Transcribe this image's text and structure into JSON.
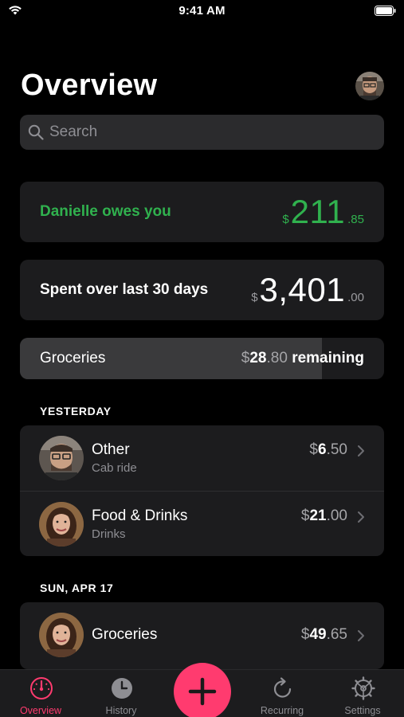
{
  "status_bar": {
    "time": "9:41 AM"
  },
  "header": {
    "title": "Overview"
  },
  "search": {
    "placeholder": "Search"
  },
  "owes_card": {
    "label": "Danielle owes you",
    "currency": "$",
    "whole": "211",
    "cents": ".85"
  },
  "spent_card": {
    "label": "Spent over last 30 days",
    "currency": "$",
    "whole": "3,401",
    "cents": ".00"
  },
  "budget": {
    "label": "Groceries",
    "amount_currency": "$",
    "amount_whole": "28",
    "amount_cents": ".80",
    "suffix": " remaining",
    "fill_fraction": 0.83
  },
  "sections": [
    {
      "header": "YESTERDAY",
      "items": [
        {
          "title": "Other",
          "subtitle": "Cab ride",
          "currency": "$",
          "whole": "6",
          "cents": ".50",
          "avatar": "man-avatar"
        },
        {
          "title": "Food & Drinks",
          "subtitle": "Drinks",
          "currency": "$",
          "whole": "21",
          "cents": ".00",
          "avatar": "woman-avatar"
        }
      ]
    },
    {
      "header": "SUN, APR 17",
      "items": [
        {
          "title": "Groceries",
          "currency": "$",
          "whole": "49",
          "cents": ".65",
          "avatar": "woman-avatar"
        }
      ]
    }
  ],
  "tab_bar": {
    "tabs": [
      {
        "label": "Overview",
        "icon": "gauge-icon",
        "active": true
      },
      {
        "label": "History",
        "icon": "clock-icon",
        "active": false
      },
      {
        "label": "Recurring",
        "icon": "refresh-icon",
        "active": false
      },
      {
        "label": "Settings",
        "icon": "gear-icon",
        "active": false
      }
    ],
    "add_icon": "plus-icon"
  },
  "colors": {
    "accent": "#ff3b6f",
    "positive": "#30b14e",
    "card": "#1c1c1e",
    "background": "#000000"
  }
}
